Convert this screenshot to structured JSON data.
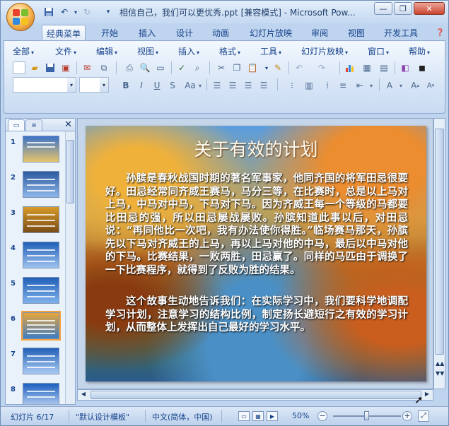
{
  "window": {
    "title": "相信自己，我们可以更优秀.ppt [兼容模式] - Microsoft Pow..."
  },
  "tabs": [
    "经典菜单",
    "开始",
    "插入",
    "设计",
    "动画",
    "幻灯片放映",
    "审阅",
    "视图",
    "开发工具"
  ],
  "menus": [
    "全部",
    "文件",
    "编辑",
    "视图",
    "插入",
    "格式",
    "工具",
    "幻灯片放映",
    "窗口",
    "帮助"
  ],
  "slides_panel": {
    "numbers": [
      "1",
      "2",
      "3",
      "4",
      "5",
      "6",
      "7",
      "8"
    ],
    "selected": "6"
  },
  "slide": {
    "title": "关于有效的计划",
    "paragraph1": "孙膑是春秋战国时期的著名军事家，他同齐国的将军田忌很要好。田忌经常同齐威王赛马，马分三等，在比赛时，总是以上马对上马，中马对中马，下马对下马。因为齐威王每一个等级的马都要比田忌的强，所以田忌屡战屡败。孙膑知道此事以后，对田忌说：“再同他比一次吧，我有办法使你得胜。”临场赛马那天，孙膑先以下马对齐威王的上马，再以上马对他的中马，最后以中马对他的下马。比赛结果，一败两胜，田忌赢了。同样的马匹由于调换了一下比赛程序，就得到了反败为胜的结果。",
    "paragraph2": "这个故事生动地告诉我们：在实际学习中，我们要科学地调配学习计划，注意学习的结构比例，制定扬长避短行之有效的学习计划，从而整体上发挥出自己最好的学习水平。"
  },
  "status": {
    "slide_info": "幻灯片 6/17",
    "template": "\"默认设计模板\"",
    "language": "中文(简体，中国)",
    "zoom": "50%",
    "zoom_fraction": 0.5
  }
}
